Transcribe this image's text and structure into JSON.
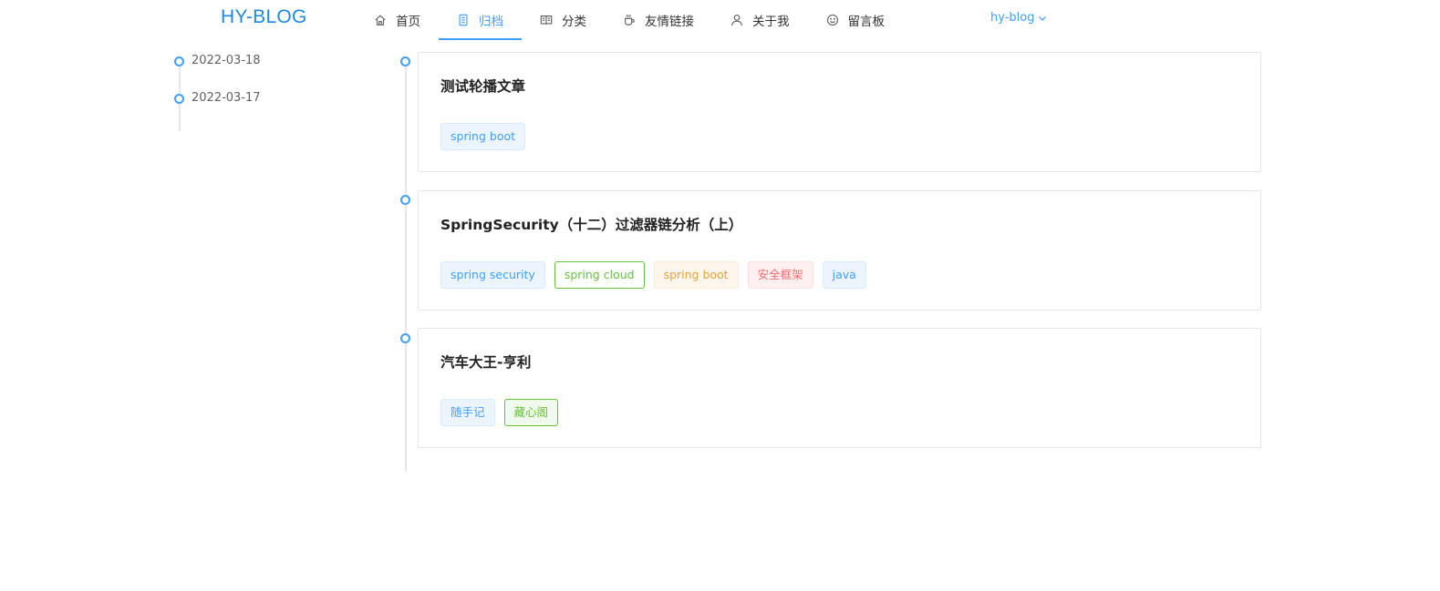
{
  "header": {
    "logo": "HY-BLOG",
    "nav": [
      {
        "label": "首页",
        "icon": "home-icon"
      },
      {
        "label": "归档",
        "icon": "document-icon",
        "active": true
      },
      {
        "label": "分类",
        "icon": "book-icon"
      },
      {
        "label": "友情链接",
        "icon": "cup-icon"
      },
      {
        "label": "关于我",
        "icon": "user-icon"
      },
      {
        "label": "留言板",
        "icon": "smile-icon"
      }
    ],
    "user": "hy-blog",
    "accent": "#409eff"
  },
  "dates": [
    {
      "label": "2022-03-18"
    },
    {
      "label": "2022-03-17"
    }
  ],
  "articles": [
    {
      "title": "测试轮播文章",
      "tags": [
        {
          "label": "spring boot",
          "style": "blue"
        }
      ]
    },
    {
      "title": "SpringSecurity（十二）过滤器链分析（上）",
      "tags": [
        {
          "label": "spring security",
          "style": "blue"
        },
        {
          "label": "spring cloud",
          "style": "green"
        },
        {
          "label": "spring boot",
          "style": "orange"
        },
        {
          "label": "安全框架",
          "style": "red"
        },
        {
          "label": "java",
          "style": "blue"
        }
      ]
    },
    {
      "title": "汽车大王-亨利",
      "tags": [
        {
          "label": "随手记",
          "style": "blue"
        },
        {
          "label": "藏心阁",
          "style": "greenl"
        }
      ]
    }
  ]
}
